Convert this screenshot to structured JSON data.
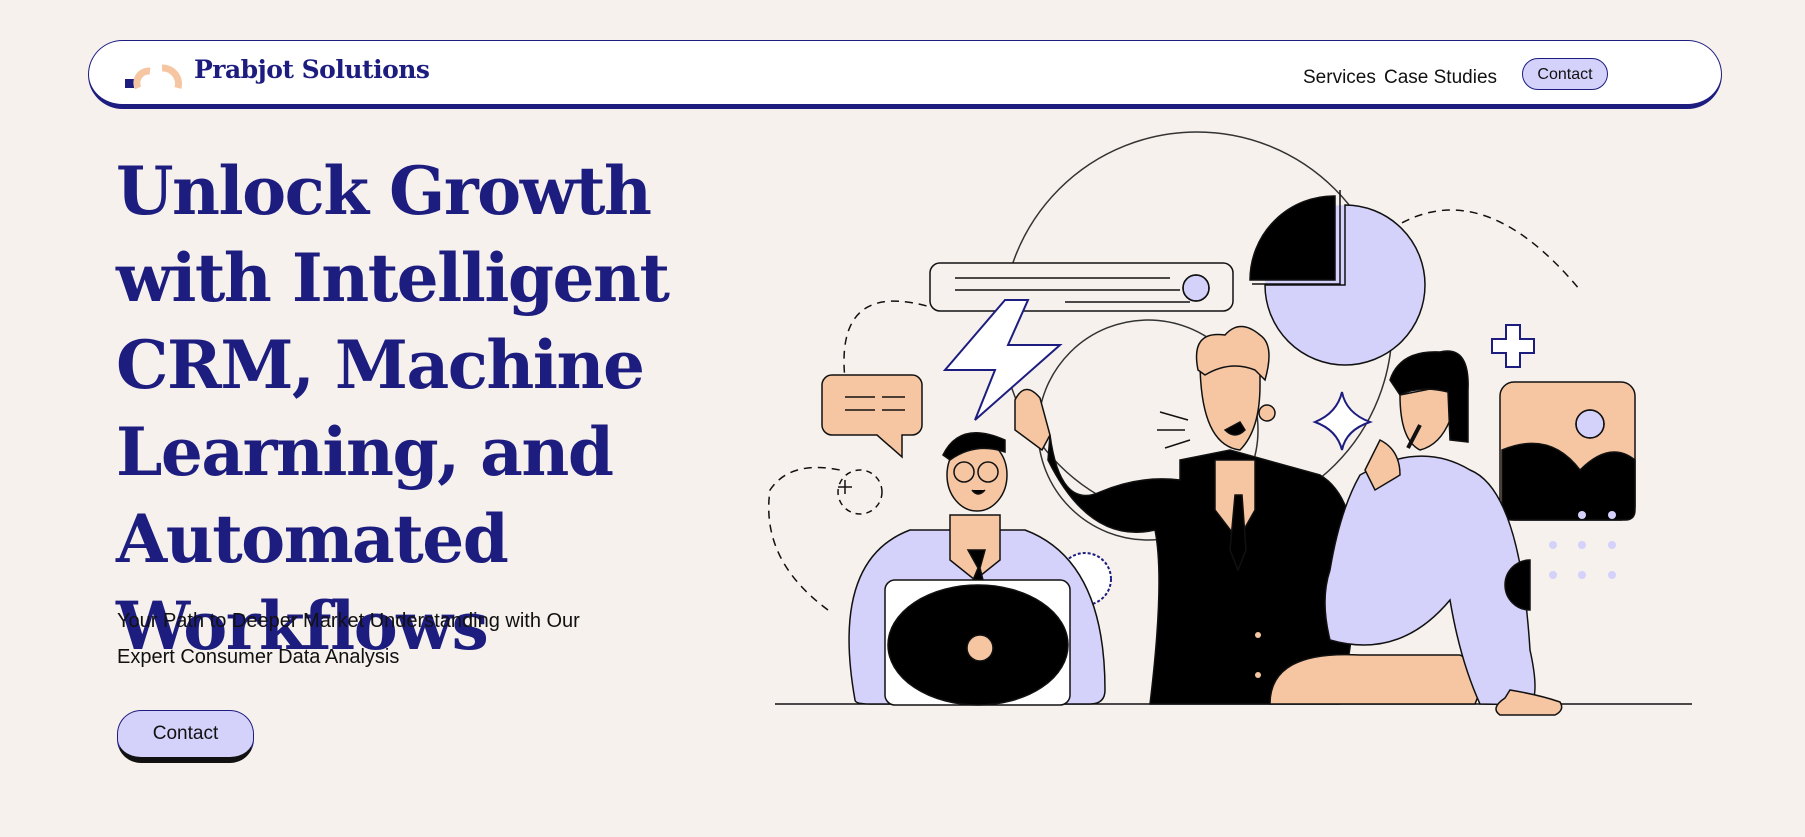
{
  "header": {
    "brand": "Prabjot Solutions",
    "logo_icon": "logo-mark-icon",
    "nav": [
      {
        "label": "Services"
      },
      {
        "label": "Case Studies"
      }
    ],
    "contact_label": "Contact"
  },
  "hero": {
    "title": "Unlock Growth with Intelligent CRM, Machine Learning, and Automated Workflows",
    "subtitle": "Your Path to Deeper Market Understanding with Our Expert Consumer Data Analysis",
    "cta_label": "Contact"
  },
  "illustration": {
    "icons": [
      "lightning-icon",
      "pie-chart-icon",
      "chat-bubble-icon",
      "plus-icon",
      "sparkle-icon",
      "badge-icon",
      "image-card-icon"
    ]
  },
  "colors": {
    "brand": "#1d1d80",
    "background": "#f6f1ed",
    "accent_lavender": "#d4d1fa",
    "accent_peach": "#f6c6a3"
  }
}
